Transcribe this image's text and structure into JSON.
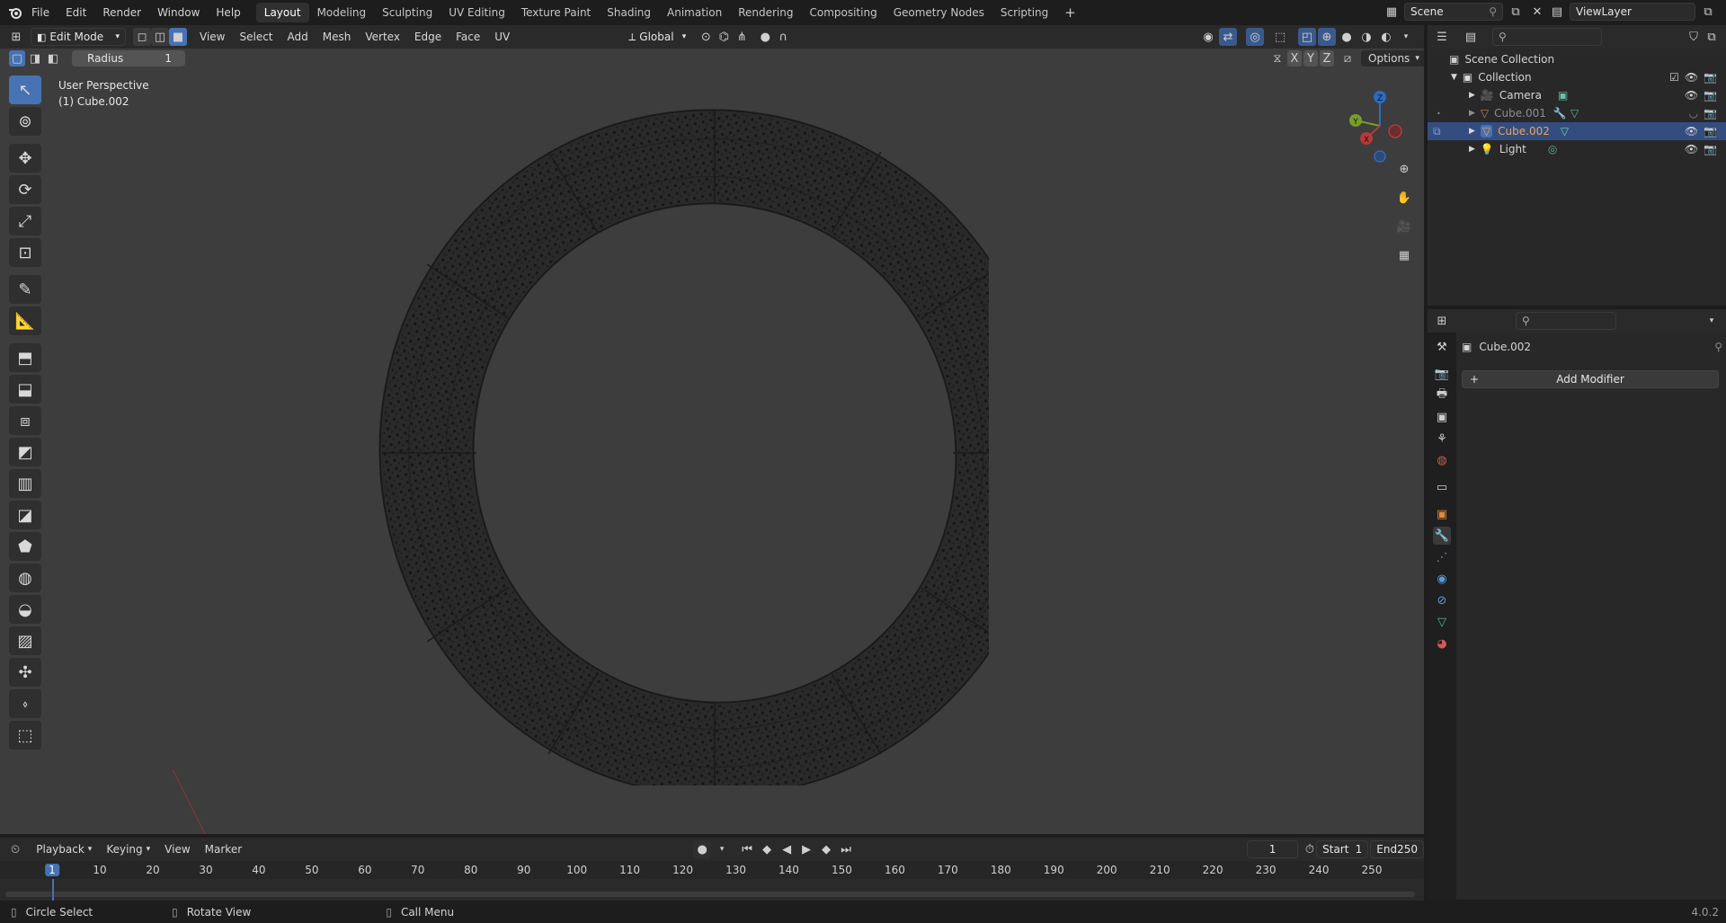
{
  "topbar": {
    "menus": [
      "File",
      "Edit",
      "Render",
      "Window",
      "Help"
    ],
    "workspaces": [
      "Layout",
      "Modeling",
      "Sculpting",
      "UV Editing",
      "Texture Paint",
      "Shading",
      "Animation",
      "Rendering",
      "Compositing",
      "Geometry Nodes",
      "Scripting"
    ],
    "active_workspace": "Layout",
    "add_symbol": "+",
    "scene_label": "Scene",
    "viewlayer_label": "ViewLayer"
  },
  "viewport_header": {
    "mode": "Edit Mode",
    "menus": [
      "View",
      "Select",
      "Add",
      "Mesh",
      "Vertex",
      "Edge",
      "Face",
      "UV"
    ],
    "orientation": "Global",
    "radius_label": "Radius",
    "radius_value": "1",
    "axes": [
      "X",
      "Y",
      "Z"
    ],
    "options_label": "Options"
  },
  "viewport": {
    "view_name": "User Perspective",
    "object_name": "(1) Cube.002",
    "gizmo_axes": [
      "X",
      "Y",
      "Z"
    ]
  },
  "outliner": {
    "root": "Scene Collection",
    "collection": "Collection",
    "items": [
      {
        "label": "Camera",
        "selected": false,
        "color": "#d4d4d4"
      },
      {
        "label": "Cube.001",
        "selected": false,
        "color": "#8d8d8d"
      },
      {
        "label": "Cube.002",
        "selected": true,
        "color": "#f0a35a"
      },
      {
        "label": "Light",
        "selected": false,
        "color": "#d4d4d4"
      }
    ]
  },
  "properties": {
    "object_name": "Cube.002",
    "add_modifier_label": "Add Modifier"
  },
  "timeline": {
    "menus": [
      "Playback",
      "Keying",
      "View",
      "Marker"
    ],
    "current_frame": "1",
    "start_label": "Start",
    "start_value": "1",
    "end_label": "End",
    "end_value": "250",
    "ticks": [
      "1",
      "10",
      "20",
      "30",
      "40",
      "50",
      "60",
      "70",
      "80",
      "90",
      "100",
      "110",
      "120",
      "130",
      "140",
      "150",
      "160",
      "170",
      "180",
      "190",
      "200",
      "210",
      "220",
      "230",
      "240",
      "250"
    ]
  },
  "statusbar": {
    "items": [
      "Circle Select",
      "Rotate View",
      "Call Menu"
    ],
    "version": "4.0.2"
  },
  "colors": {
    "accent": "#4772b3",
    "selected_row": "#334d80",
    "viewport_bg": "#3d3d3d",
    "panel_bg": "#282828",
    "frame_marker": "#4772b3"
  }
}
